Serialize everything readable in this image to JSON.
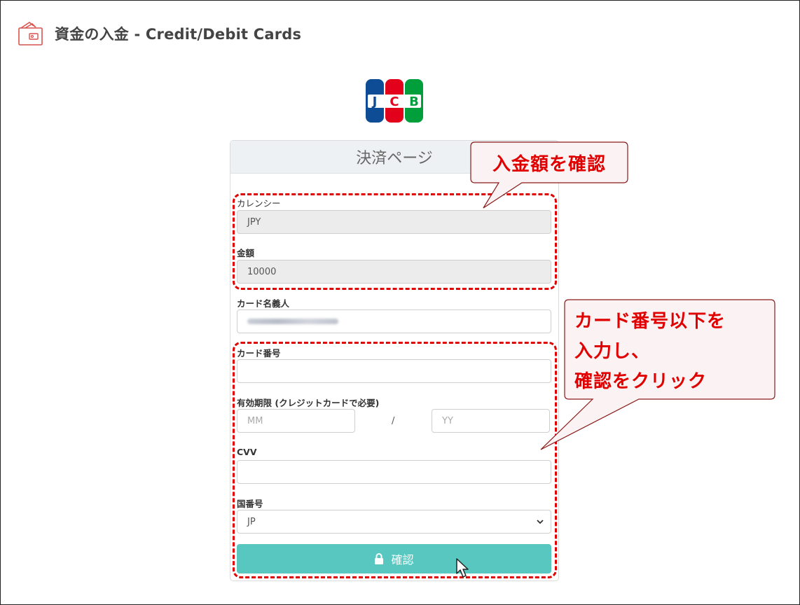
{
  "header": {
    "icon": "wallet-icon",
    "title": "資金の入金 - Credit/Debit Cards"
  },
  "logo": {
    "letters": "JCB",
    "colors": [
      "#0e4c96",
      "#e2001a",
      "#009f3c"
    ]
  },
  "form": {
    "heading": "決済ページ",
    "currency": {
      "label": "カレンシー",
      "value": "JPY"
    },
    "amount": {
      "label": "金額",
      "value": "10000"
    },
    "cardholder": {
      "label": "カード名義人"
    },
    "card_number": {
      "label": "カード番号",
      "value": ""
    },
    "expiry": {
      "label": "有効期限 (クレジットカードで必要)",
      "month_placeholder": "MM",
      "separator": "/",
      "year_placeholder": "YY"
    },
    "cvv": {
      "label": "CVV",
      "value": ""
    },
    "country": {
      "label": "国番号",
      "selected": "JP"
    },
    "submit": {
      "label": "確認",
      "icon": "lock-icon",
      "color": "#57c7c0"
    }
  },
  "annotations": {
    "callout_1": "入金額を確認",
    "callout_2": [
      "カード番号以下を",
      "入力し、",
      "確認をクリック"
    ],
    "color": "#e00000"
  }
}
